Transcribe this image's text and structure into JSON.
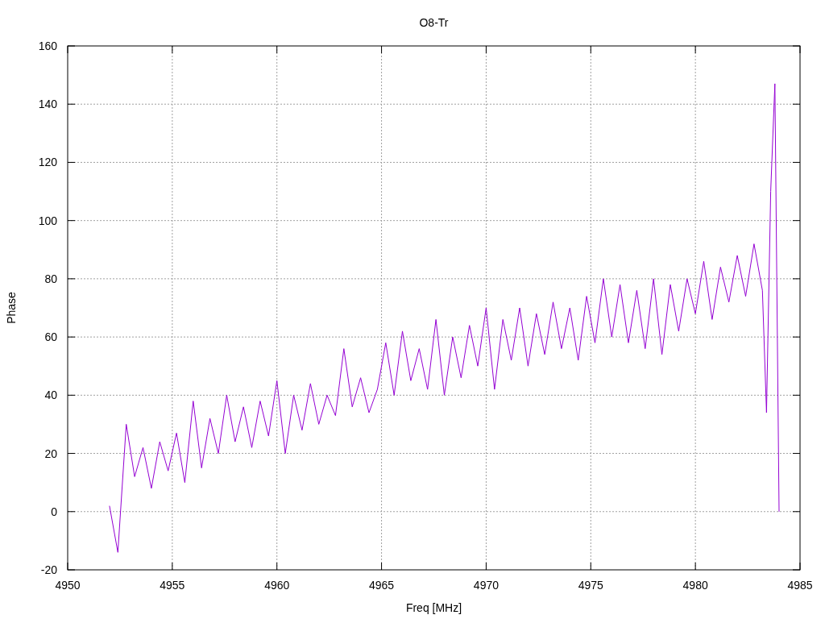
{
  "chart_data": {
    "type": "line",
    "title": "O8-Tr",
    "xlabel": "Freq [MHz]",
    "ylabel": "Phase",
    "x": [
      4952.0,
      4952.4,
      4952.8,
      4953.2,
      4953.6,
      4954.0,
      4954.4,
      4954.8,
      4955.2,
      4955.6,
      4956.0,
      4956.4,
      4956.8,
      4957.2,
      4957.6,
      4958.0,
      4958.4,
      4958.8,
      4959.2,
      4959.6,
      4960.0,
      4960.4,
      4960.8,
      4961.2,
      4961.6,
      4962.0,
      4962.4,
      4962.8,
      4963.2,
      4963.6,
      4964.0,
      4964.4,
      4964.8,
      4965.2,
      4965.6,
      4966.0,
      4966.4,
      4966.8,
      4967.2,
      4967.6,
      4968.0,
      4968.4,
      4968.8,
      4969.2,
      4969.6,
      4970.0,
      4970.4,
      4970.8,
      4971.2,
      4971.6,
      4972.0,
      4972.4,
      4972.8,
      4973.2,
      4973.6,
      4974.0,
      4974.4,
      4974.8,
      4975.2,
      4975.6,
      4976.0,
      4976.4,
      4976.8,
      4977.2,
      4977.6,
      4978.0,
      4978.4,
      4978.8,
      4979.2,
      4979.6,
      4980.0,
      4980.4,
      4980.8,
      4981.2,
      4981.6,
      4982.0,
      4982.4,
      4982.8,
      4983.2,
      4983.4,
      4983.6,
      4983.8,
      4984.0
    ],
    "series": [
      {
        "color": "#9400d3",
        "values": [
          2,
          -14,
          30,
          12,
          22,
          8,
          24,
          14,
          27,
          10,
          38,
          15,
          32,
          20,
          40,
          24,
          36,
          22,
          38,
          26,
          45,
          20,
          40,
          28,
          44,
          30,
          40,
          33,
          56,
          36,
          46,
          34,
          42,
          58,
          40,
          62,
          45,
          56,
          42,
          66,
          40,
          60,
          46,
          64,
          50,
          70,
          42,
          66,
          52,
          70,
          50,
          68,
          54,
          72,
          56,
          70,
          52,
          74,
          58,
          80,
          60,
          78,
          58,
          76,
          56,
          80,
          54,
          78,
          62,
          80,
          68,
          86,
          66,
          84,
          72,
          88,
          74,
          92,
          76,
          34,
          110,
          147,
          0
        ]
      }
    ],
    "xlim": [
      4950,
      4985
    ],
    "ylim": [
      -20,
      160
    ],
    "xticks": [
      4950,
      4955,
      4960,
      4965,
      4970,
      4975,
      4980,
      4985
    ],
    "yticks": [
      -20,
      0,
      20,
      40,
      60,
      80,
      100,
      120,
      140,
      160
    ],
    "grid": true
  }
}
